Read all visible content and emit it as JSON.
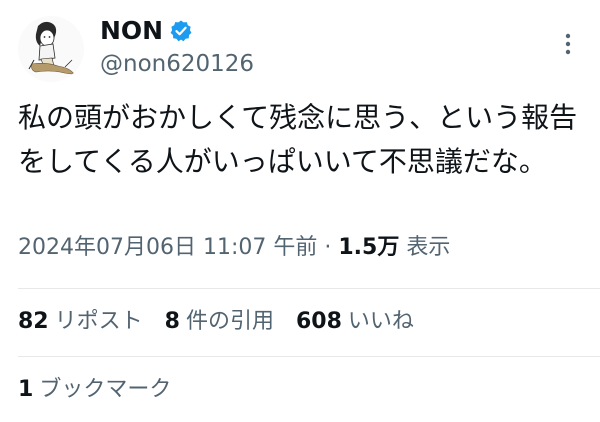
{
  "user": {
    "display_name": "NON",
    "handle": "@non620126"
  },
  "icons": {
    "avatar": "cartoon-girl-avatar",
    "verified": "verified-badge-icon",
    "more": "more-options-icon"
  },
  "tweet": {
    "text": "私の頭がおかしくて残念に思う、という報告をしてくる人がいっぱいいて不思議だな。"
  },
  "meta": {
    "datetime": "2024年07月06日 11:07 午前",
    "separator": "·",
    "views_count": "1.5万",
    "views_label": "表示"
  },
  "stats": [
    {
      "count": "82",
      "label": "リポスト"
    },
    {
      "count": "8",
      "label": "件の引用"
    },
    {
      "count": "608",
      "label": "いいね"
    }
  ],
  "bookmarks": {
    "count": "1",
    "label": "ブックマーク"
  },
  "colors": {
    "text_primary": "#0f1419",
    "text_secondary": "#536471",
    "verified_blue": "#1d9bf0",
    "divider": "#e6e8ea"
  }
}
